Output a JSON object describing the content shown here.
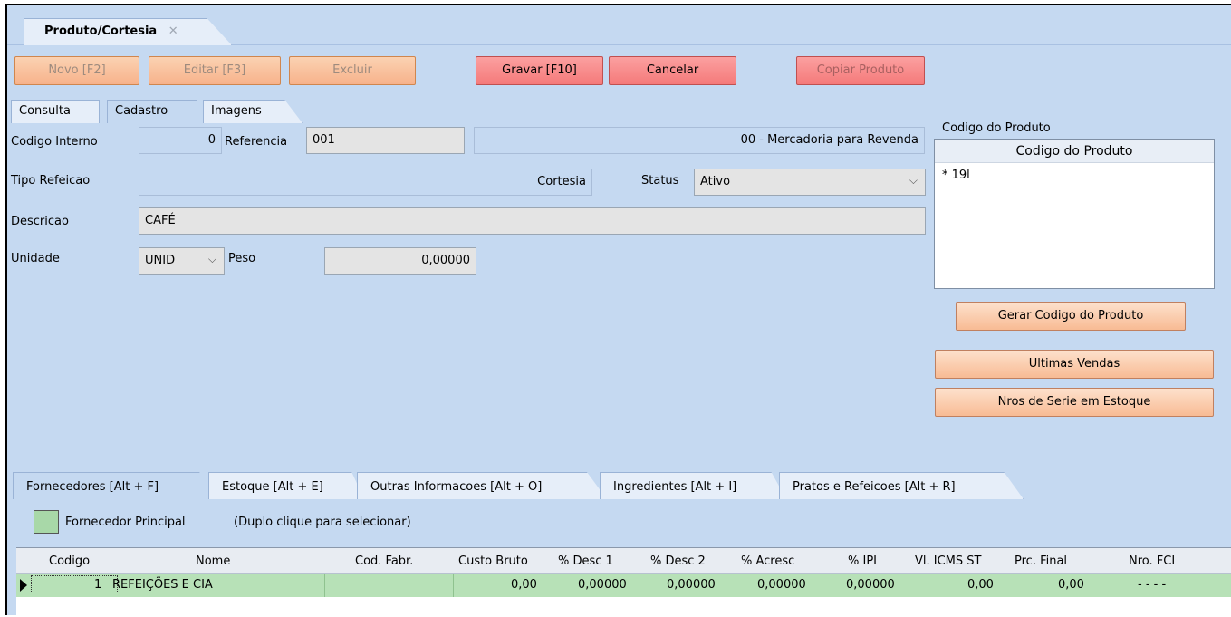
{
  "window": {
    "doc_tab": "Produto/Cortesia",
    "close_glyph": "✕"
  },
  "toolbar": {
    "novo": "Novo [F2]",
    "editar": "Editar [F3]",
    "excluir": "Excluir",
    "gravar": "Gravar [F10]",
    "cancelar": "Cancelar",
    "copiar": "Copiar Produto"
  },
  "tabs": {
    "consulta": "Consulta",
    "cadastro": "Cadastro",
    "imagens": "Imagens"
  },
  "form": {
    "codigo_interno_label": "Codigo Interno",
    "codigo_interno_value": "0",
    "referencia_label": "Referencia",
    "referencia_value": "001",
    "tipo_mercadoria": "00 - Mercadoria para Revenda",
    "tipo_refeicao_label": "Tipo Refeicao",
    "tipo_refeicao_value": "Cortesia",
    "status_label": "Status",
    "status_value": "Ativo",
    "descricao_label": "Descricao",
    "descricao_value": "CAFÉ",
    "unidade_label": "Unidade",
    "unidade_value": "UNID",
    "peso_label": "Peso",
    "peso_value": "0,00000"
  },
  "codigo_produto": {
    "section_label": "Codigo do Produto",
    "header": "Codigo do Produto",
    "row_marker": "*",
    "row_value": "19l",
    "gerar_button": "Gerar Codigo do Produto"
  },
  "side_buttons": {
    "ultimas_vendas": "Ultimas Vendas",
    "nros_serie": "Nros de Serie em Estoque"
  },
  "bottom_tabs": [
    {
      "label": "Fornecedores [Alt + F]"
    },
    {
      "label": "Estoque [Alt + E]"
    },
    {
      "label": "Outras Informacoes [Alt + O]"
    },
    {
      "label": "Ingredientes [Alt + I]"
    },
    {
      "label": "Pratos e Refeicoes [Alt + R]"
    }
  ],
  "legend": {
    "label": "Fornecedor Principal",
    "hint": "(Duplo clique para selecionar)",
    "color": "#a8d8a8"
  },
  "grid": {
    "columns": [
      "Codigo",
      "Nome",
      "Cod. Fabr.",
      "Custo Bruto",
      "% Desc 1",
      "% Desc 2",
      "% Acresc",
      "% IPI",
      "Vl. ICMS ST",
      "Prc. Final",
      "Nro. FCI"
    ],
    "rows": [
      {
        "codigo": "1",
        "nome": "REFEIÇÕES E CIA",
        "cod_fabr": "",
        "custo_bruto": "0,00",
        "desc1": "0,00000",
        "desc2": "0,00000",
        "acresc": "0,00000",
        "ipi": "0,00000",
        "icms_st": "0,00",
        "prc_final": "0,00",
        "nro_fci": "-   -   -   -"
      }
    ]
  }
}
